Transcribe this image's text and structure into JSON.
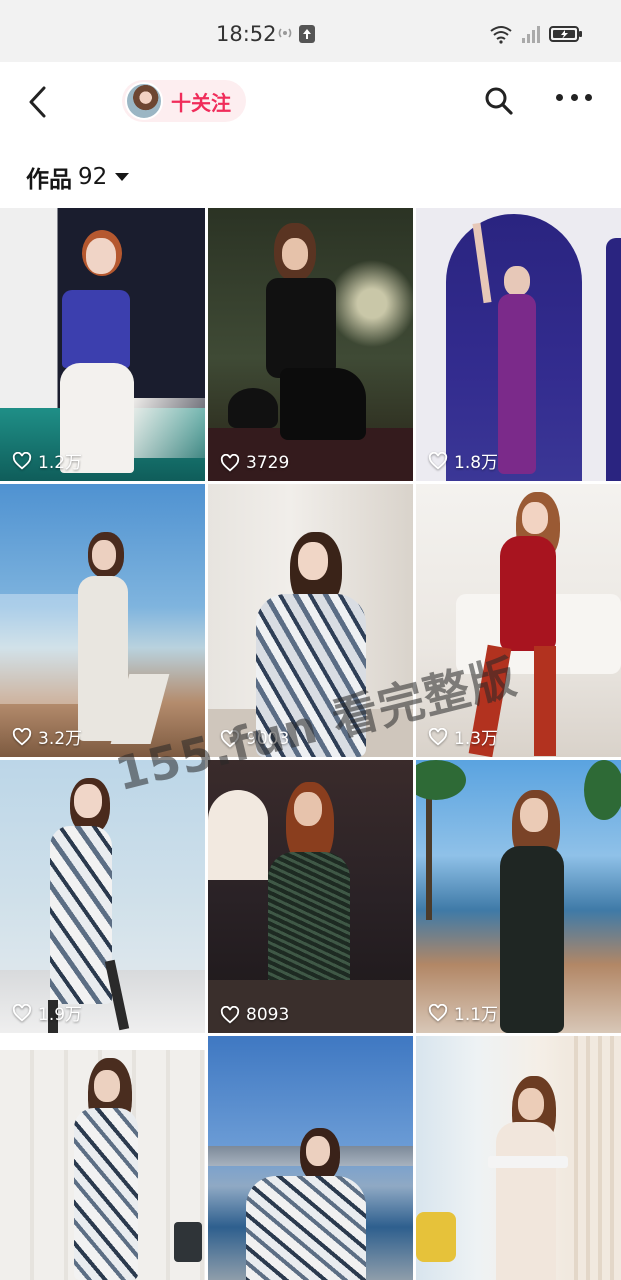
{
  "status_bar": {
    "time": "18:52"
  },
  "nav": {
    "follow_label": "十关注"
  },
  "works": {
    "label": "作品",
    "count": "92"
  },
  "tiles": [
    {
      "likes": "1.2万"
    },
    {
      "likes": "3729"
    },
    {
      "likes": "1.8万"
    },
    {
      "likes": "3.2万"
    },
    {
      "likes": "9003"
    },
    {
      "likes": "1.3万"
    },
    {
      "likes": "1.9万"
    },
    {
      "likes": "8093"
    },
    {
      "likes": "1.1万"
    },
    {
      "likes": ""
    },
    {
      "likes": ""
    },
    {
      "likes": ""
    }
  ],
  "watermark": "155.fun 看完整版",
  "icons": [
    "back-arrow-icon",
    "search-icon",
    "more-icon",
    "heart-icon",
    "wifi-icon",
    "signal-icon",
    "battery-icon",
    "upload-icon",
    "hotspot-icon"
  ]
}
